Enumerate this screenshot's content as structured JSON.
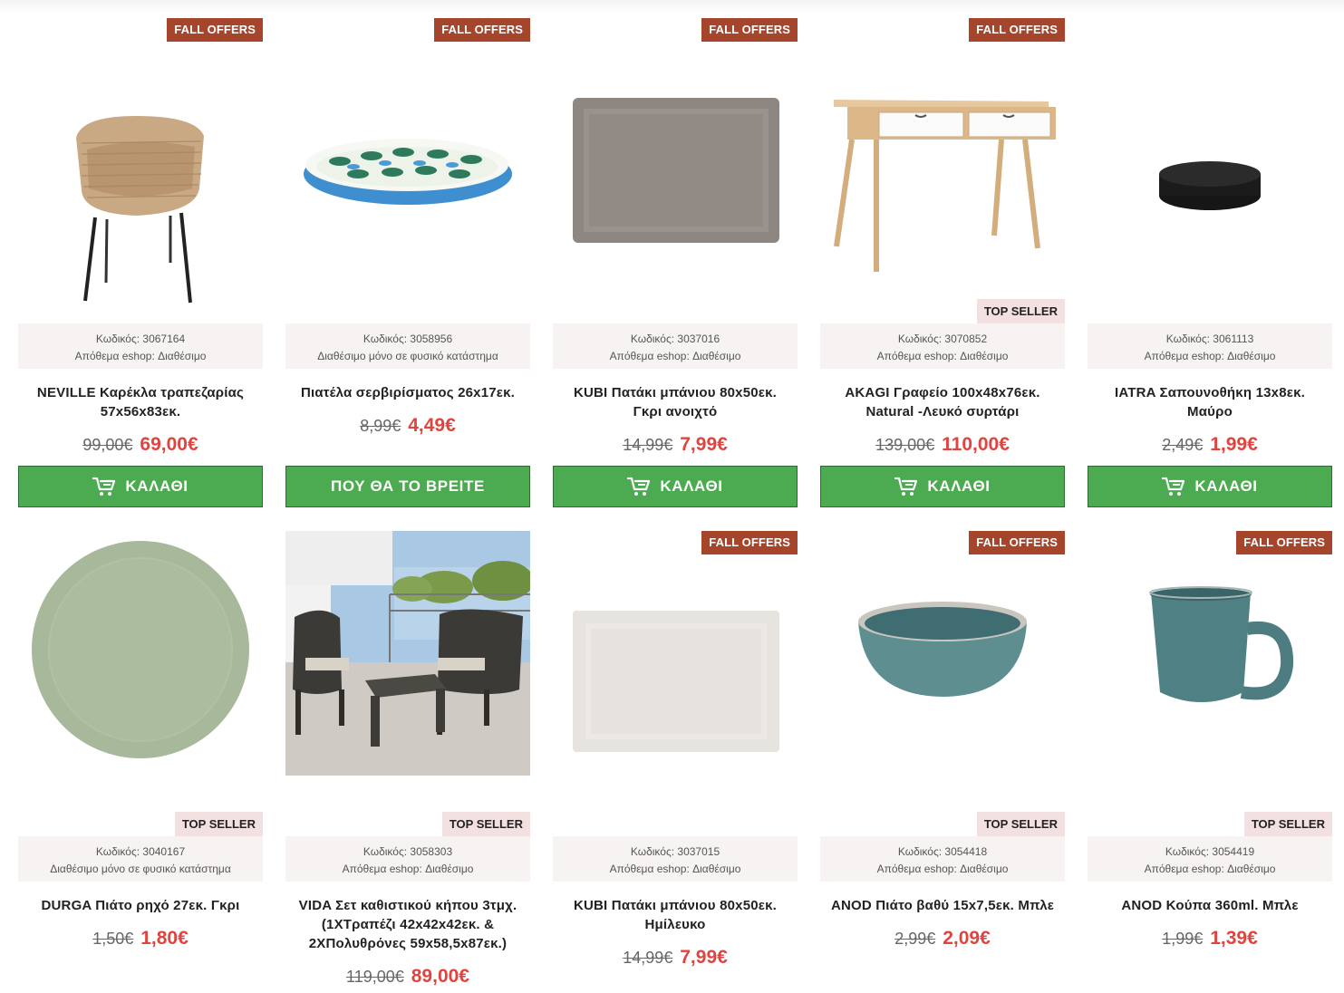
{
  "labels": {
    "fall_offers": "FALL OFFERS",
    "top_seller": "TOP SELLER",
    "cart_button": "ΚΑΛΑΘΙ",
    "find_button": "ΠΟΥ ΘΑ ΤΟ ΒΡΕΙΤΕ"
  },
  "colors": {
    "ribbon": "#a4452c",
    "top_seller_bg": "#f3e1e1",
    "button": "#4caa50",
    "new_price": "#e0443f"
  },
  "products": [
    {
      "code": "Κωδικός: 3067164",
      "stock": "Απόθεμα eshop: Διαθέσιμο",
      "name": "NEVILLE Καρέκλα τραπεζαρίας 57x56x83εκ.",
      "old_price": "99,00€",
      "new_price": "69,00€",
      "button": "cart",
      "fall_offers": true,
      "top_seller": false,
      "image": "rattan-chair-icon"
    },
    {
      "code": "Κωδικός: 3058956",
      "stock": "Διαθέσιμο μόνο σε φυσικό κατάστημα",
      "name": "Πιατέλα σερβιρίσματος 26x17εκ.",
      "old_price": "8,99€",
      "new_price": "4,49€",
      "button": "find",
      "fall_offers": true,
      "top_seller": false,
      "image": "fish-platter-icon"
    },
    {
      "code": "Κωδικός: 3037016",
      "stock": "Απόθεμα eshop: Διαθέσιμο",
      "name": "KUBI Πατάκι μπάνιου 80x50εκ. Γκρι ανοιχτό",
      "old_price": "14,99€",
      "new_price": "7,99€",
      "button": "cart",
      "fall_offers": true,
      "top_seller": false,
      "image": "grey-bath-mat-icon"
    },
    {
      "code": "Κωδικός: 3070852",
      "stock": "Απόθεμα eshop: Διαθέσιμο",
      "name": "AKAGI Γραφείο 100x48x76εκ. Natural -Λευκό συρτάρι",
      "old_price": "139,00€",
      "new_price": "110,00€",
      "button": "cart",
      "fall_offers": true,
      "top_seller": true,
      "image": "desk-icon"
    },
    {
      "code": "Κωδικός: 3061113",
      "stock": "Απόθεμα eshop: Διαθέσιμο",
      "name": "IATRA Σαπουνοθήκη 13x8εκ. Μαύρο",
      "old_price": "2,49€",
      "new_price": "1,99€",
      "button": "cart",
      "fall_offers": false,
      "top_seller": false,
      "image": "soap-dish-icon"
    },
    {
      "code": "Κωδικός: 3040167",
      "stock": "Διαθέσιμο μόνο σε φυσικό κατάστημα",
      "name": "DURGA Πιάτο ρηχό 27εκ. Γκρι",
      "old_price": "1,50€",
      "new_price": "1,80€",
      "button": "none",
      "fall_offers": false,
      "top_seller": true,
      "image": "green-plate-icon"
    },
    {
      "code": "Κωδικός: 3058303",
      "stock": "Απόθεμα eshop: Διαθέσιμο",
      "name": "VIDA Σετ καθιστικού κήπου 3τμχ. (1ΧΤραπέζι 42x42x42εκ. & 2ΧΠολυθρόνες 59x58,5x87εκ.)",
      "old_price": "119,00€",
      "new_price": "89,00€",
      "button": "none",
      "fall_offers": false,
      "top_seller": true,
      "image": "garden-set-photo"
    },
    {
      "code": "Κωδικός: 3037015",
      "stock": "Απόθεμα eshop: Διαθέσιμο",
      "name": "KUBI Πατάκι μπάνιου 80x50εκ. Ημίλευκο",
      "old_price": "14,99€",
      "new_price": "7,99€",
      "button": "none",
      "fall_offers": true,
      "top_seller": false,
      "image": "white-bath-mat-icon"
    },
    {
      "code": "Κωδικός: 3054418",
      "stock": "Απόθεμα eshop: Διαθέσιμο",
      "name": "ANOD Πιάτο βαθύ 15x7,5εκ. Μπλε",
      "old_price": "2,99€",
      "new_price": "2,09€",
      "button": "none",
      "fall_offers": true,
      "top_seller": true,
      "image": "bowl-icon"
    },
    {
      "code": "Κωδικός: 3054419",
      "stock": "Απόθεμα eshop: Διαθέσιμο",
      "name": "ANOD Κούπα 360ml. Μπλε",
      "old_price": "1,99€",
      "new_price": "1,39€",
      "button": "none",
      "fall_offers": true,
      "top_seller": true,
      "image": "mug-icon"
    }
  ]
}
